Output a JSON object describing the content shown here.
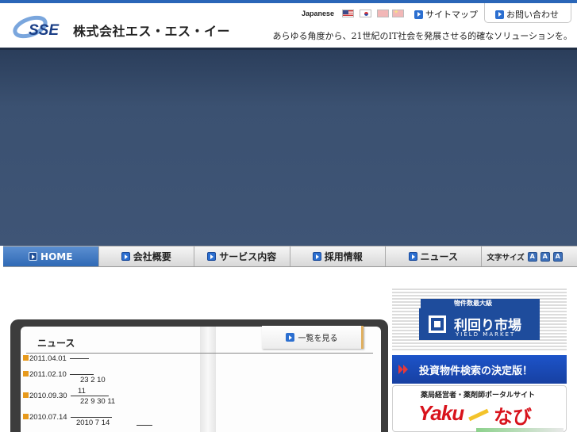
{
  "header": {
    "company_name": "株式会社エス・エス・イー",
    "logo_text": "SSE",
    "language_label": "Japanese",
    "sitemap_label": "サイトマップ",
    "contact_label": "お問い合わせ",
    "tagline": "あらゆる角度から、21世紀のIT社会を発展させる的確なソリューションを。",
    "colors": {
      "accent": "#2a66b8",
      "hero": "#3f5576"
    }
  },
  "nav": {
    "items": [
      {
        "label": "HOME"
      },
      {
        "label": "会社概要"
      },
      {
        "label": "サービス内容"
      },
      {
        "label": "採用情報"
      },
      {
        "label": "ニュース"
      }
    ],
    "font_size_label": "文字サイズ",
    "font_size_buttons": [
      "A",
      "A",
      "A"
    ]
  },
  "news": {
    "title": "ニュース",
    "more_label": "一覧を見る",
    "items": [
      {
        "date": "2011.04.01",
        "sub": ""
      },
      {
        "date": "2011.02.10",
        "sub": "23 2 10"
      },
      {
        "date": "2010.09.30",
        "pre": "11",
        "sub": "22 9 30    11"
      },
      {
        "date": "2010.07.14",
        "sub": "2010 7 14"
      }
    ]
  },
  "banners": {
    "yield": {
      "top_label": "物件数最大級",
      "name": "利回り市場",
      "sub": "YIELD MARKET"
    },
    "search": {
      "label": "投資物件検索の決定版！"
    },
    "yaku": {
      "top_label": "薬局経営者・薬剤師ポータルサイト",
      "logo": "Yaku",
      "navi": "なび"
    }
  }
}
